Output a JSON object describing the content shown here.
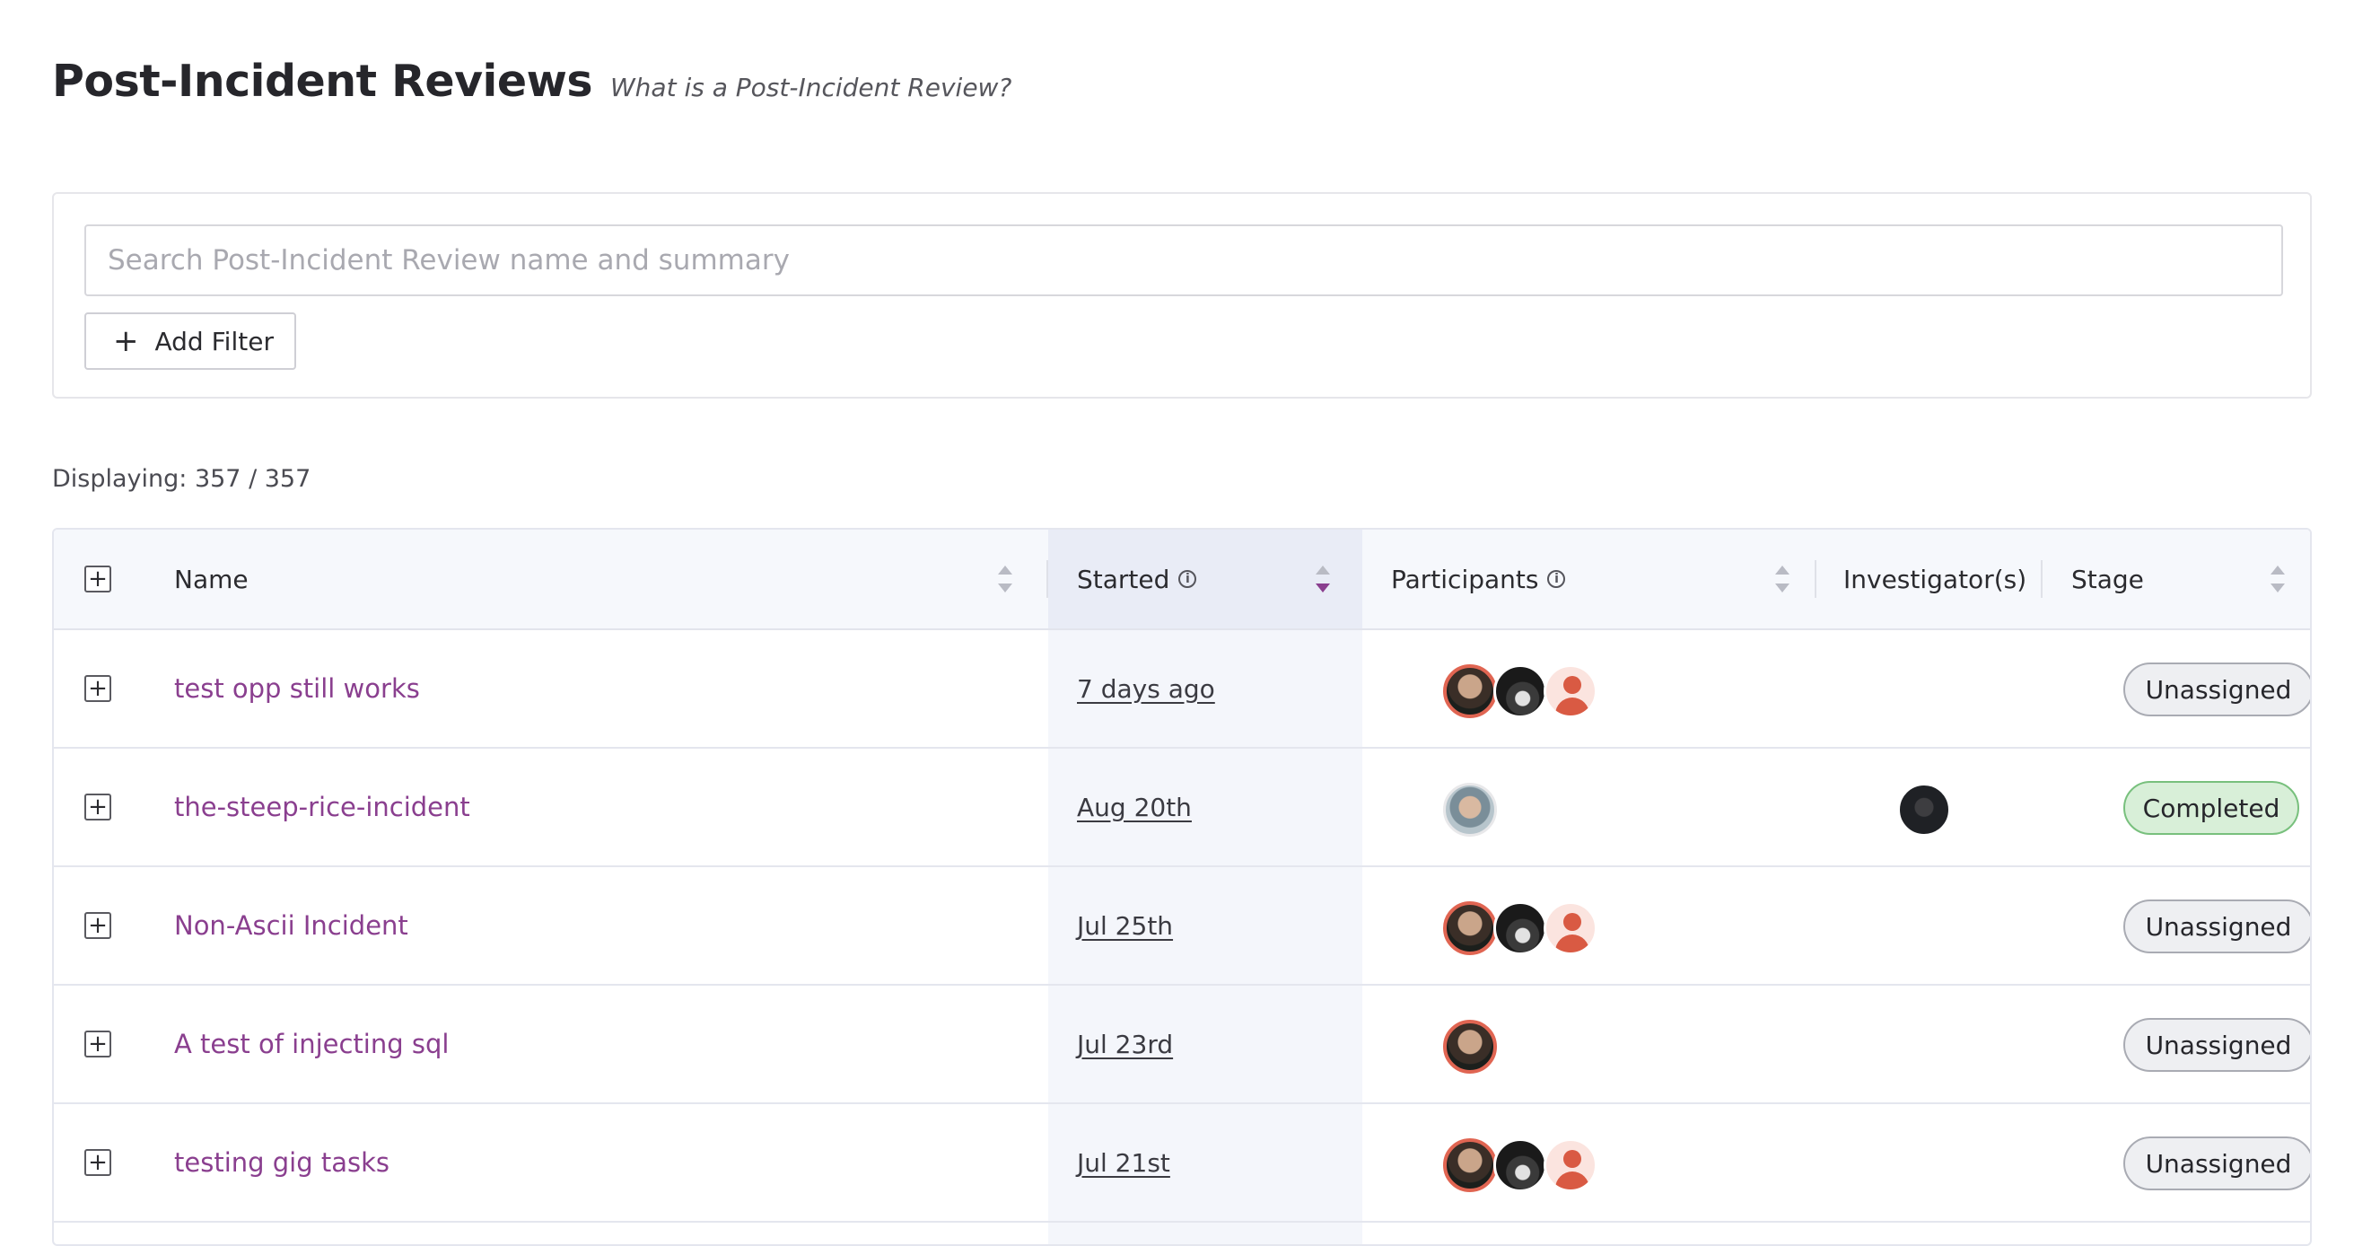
{
  "page": {
    "title": "Post-Incident Reviews",
    "help_link": "What is a Post-Incident Review?"
  },
  "filters": {
    "search_placeholder": "Search Post-Incident Review name and summary",
    "search_value": "",
    "add_filter_label": "Add Filter"
  },
  "summary": {
    "displaying": "Displaying: 357 / 357"
  },
  "table": {
    "columns": {
      "name": "Name",
      "started": "Started",
      "participants": "Participants",
      "investigators": "Investigator(s)",
      "stage": "Stage"
    },
    "sorted_by": "started",
    "sort_direction": "descending",
    "rows": [
      {
        "name": "test opp still works",
        "started": "7 days ago",
        "participants": [
          "avatar-photo-1",
          "avatar-photo-2",
          "avatar-default"
        ],
        "investigators": [],
        "stage": "Unassigned"
      },
      {
        "name": "the-steep-rice-incident",
        "started": "Aug 20th",
        "participants": [
          "avatar-photo-3"
        ],
        "investigators": [
          "avatar-photo-4"
        ],
        "stage": "Completed"
      },
      {
        "name": "Non-Ascii Incident",
        "started": "Jul 25th",
        "participants": [
          "avatar-photo-1",
          "avatar-photo-2",
          "avatar-default"
        ],
        "investigators": [],
        "stage": "Unassigned"
      },
      {
        "name": "A test of injecting sql",
        "started": "Jul 23rd",
        "participants": [
          "avatar-photo-1"
        ],
        "investigators": [],
        "stage": "Unassigned"
      },
      {
        "name": "testing gig tasks",
        "started": "Jul 21st",
        "participants": [
          "avatar-photo-1",
          "avatar-photo-2",
          "avatar-default"
        ],
        "investigators": [],
        "stage": "Unassigned"
      }
    ]
  },
  "colors": {
    "link": "#8a3f8f",
    "completed_bg": "#d8efd8",
    "completed_border": "#78c07d",
    "unassigned_bg": "#eeeff2",
    "avatar_ring": "#e06552"
  }
}
